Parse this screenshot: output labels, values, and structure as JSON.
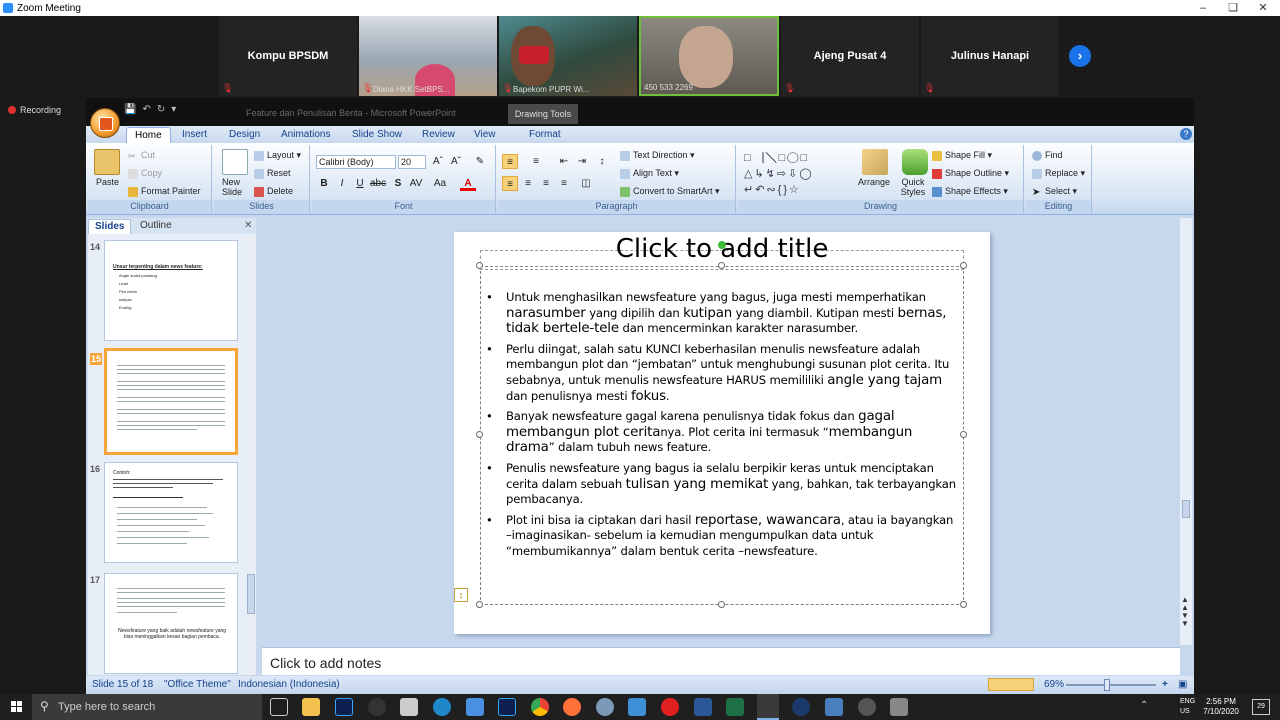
{
  "zoom": {
    "window_title": "Zoom Meeting",
    "recording_label": "Recording",
    "participants": [
      {
        "name": "Kompu BPSDM",
        "label": ""
      },
      {
        "name": "",
        "label": "Diana HKK SetBPS..."
      },
      {
        "name": "",
        "label": "Bapekom PUPR Wi..."
      },
      {
        "name": "",
        "label": "450 533 2269"
      },
      {
        "name": "Ajeng Pusat 4",
        "label": ""
      },
      {
        "name": "Julinus Hanapi",
        "label": ""
      }
    ]
  },
  "ppt": {
    "window_title": "Feature dan Penulisan Berita - Microsoft PowerPoint",
    "context_tab": "Drawing Tools",
    "tabs": [
      "Home",
      "Insert",
      "Design",
      "Animations",
      "Slide Show",
      "Review",
      "View",
      "Format"
    ],
    "ribbon": {
      "clipboard": {
        "label": "Clipboard",
        "paste": "Paste",
        "cut": "Cut",
        "copy": "Copy",
        "format_painter": "Format Painter"
      },
      "slides": {
        "label": "Slides",
        "new_slide": "New Slide",
        "layout": "Layout",
        "reset": "Reset",
        "delete": "Delete"
      },
      "font": {
        "label": "Font",
        "font_name": "Calibri (Body)",
        "font_size": "20"
      },
      "paragraph": {
        "label": "Paragraph",
        "text_direction": "Text Direction",
        "align_text": "Align Text",
        "convert_smartart": "Convert to SmartArt"
      },
      "drawing": {
        "label": "Drawing",
        "arrange": "Arrange",
        "quick_styles": "Quick Styles",
        "shape_fill": "Shape Fill",
        "shape_outline": "Shape Outline",
        "shape_effects": "Shape Effects"
      },
      "editing": {
        "label": "Editing",
        "find": "Find",
        "replace": "Replace",
        "select": "Select"
      }
    },
    "pane_tabs": [
      "Slides",
      "Outline"
    ],
    "thumbnails": [
      {
        "number": "14",
        "title": "Unsur terpenting dalam news feature:",
        "items": [
          "Angle sudut pandang",
          "Lead",
          "Plot cerita",
          "kutipan",
          "Ending"
        ]
      },
      {
        "number": "15"
      },
      {
        "number": "16",
        "title": "Contoh:"
      },
      {
        "number": "17",
        "text": "Newsfeature yang baik adalah newsfeature yang bisa meninggalkan kesan bagian pembaca."
      }
    ],
    "slide": {
      "title_placeholder": "Click to add title",
      "bullets": [
        [
          [
            "Untuk menghasilkan newsfeature yang bagus, juga mesti memperhatikan ",
            false
          ],
          [
            "narasumber",
            true
          ],
          [
            " yang dipilih dan ",
            false
          ],
          [
            "kutipan",
            true
          ],
          [
            " yang diambil. Kutipan mesti ",
            false
          ],
          [
            "bernas, tidak bertele-tele",
            true
          ],
          [
            " dan mencerminkan karakter narasumber.",
            false
          ]
        ],
        [
          [
            "Perlu diingat, salah satu KUNCI keberhasilan menulis newsfeature adalah membangun plot dan “jembatan” untuk menghubungi susunan plot cerita. Itu sebabnya, untuk menulis newsfeature HARUS memililiki ",
            false
          ],
          [
            "angle yang tajam",
            true
          ],
          [
            " dan penulisnya mesti ",
            false
          ],
          [
            "fokus",
            true
          ],
          [
            ".",
            false
          ]
        ],
        [
          [
            "Banyak newsfeature gagal karena penulisnya tidak fokus dan ",
            false
          ],
          [
            "gagal membangun plot cerita",
            true
          ],
          [
            "nya. Plot cerita ini termasuk “",
            false
          ],
          [
            "membangun drama",
            true
          ],
          [
            "” dalam tubuh news feature.",
            false
          ]
        ],
        [
          [
            "Penulis newsfeature yang bagus ia selalu berpikir keras untuk menciptakan cerita dalam sebuah ",
            false
          ],
          [
            "tulisan yang memikat",
            true
          ],
          [
            " yang, bahkan, tak terbayangkan pembacanya.",
            false
          ]
        ],
        [
          [
            "Plot ini bisa ia ciptakan dari hasil ",
            false
          ],
          [
            "reportase, wawancara",
            true
          ],
          [
            ", atau ia bayangkan –imaginasikan- sebelum ia kemudian mengumpulkan data untuk “membumikannya” dalam bentuk cerita –newsfeature.",
            false
          ]
        ]
      ]
    },
    "notes_placeholder": "Click to add notes",
    "status": {
      "slide_of": "Slide 15 of 18",
      "theme": "\"Office Theme\"",
      "language": "Indonesian (Indonesia)",
      "zoom": "69%"
    }
  },
  "taskbar": {
    "search_placeholder": "Type here to search",
    "lang_line1": "ENG",
    "lang_line2": "US",
    "time": "2:56 PM",
    "date": "7/10/2020",
    "notif_count": "29"
  }
}
